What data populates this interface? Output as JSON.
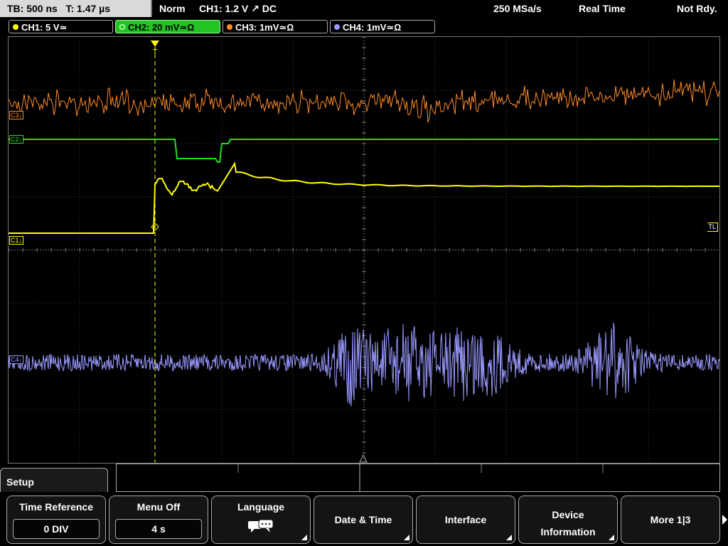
{
  "status": {
    "timebase": "TB: 500 ns",
    "trigger_time": "T: 1.47 µs",
    "mode": "Norm",
    "trigger": "CH1: 1.2 V ↗ DC",
    "sample_rate": "250 MSa/s",
    "acq": "Real Time",
    "state": "Not Rdy."
  },
  "channels": [
    {
      "label": "CH1: 5 V≃",
      "color": "#ffff00",
      "active": false
    },
    {
      "label": "CH2: 20 mV≃Ω",
      "color": "#22dd22",
      "active": true
    },
    {
      "label": "CH3: 1mV≃Ω",
      "color": "#ff8c28",
      "active": false
    },
    {
      "label": "CH4: 1mV≃Ω",
      "color": "#9999ff",
      "active": false
    }
  ],
  "markers": {
    "ch3": "C3↓",
    "ch2": "C2↓",
    "ch1": "C1↓",
    "ch4": "C4↓",
    "trigger_level": "TL"
  },
  "menu": {
    "title": "Setup",
    "buttons": [
      {
        "label": "Time Reference",
        "value": "0 DIV"
      },
      {
        "label": "Menu Off",
        "value": "4 s"
      },
      {
        "label": "Language",
        "icon": "speech-bubbles-icon"
      },
      {
        "label": "Date & Time"
      },
      {
        "label": "Interface"
      },
      {
        "label": "Device Information"
      },
      {
        "label": "More 1|3"
      }
    ]
  }
}
